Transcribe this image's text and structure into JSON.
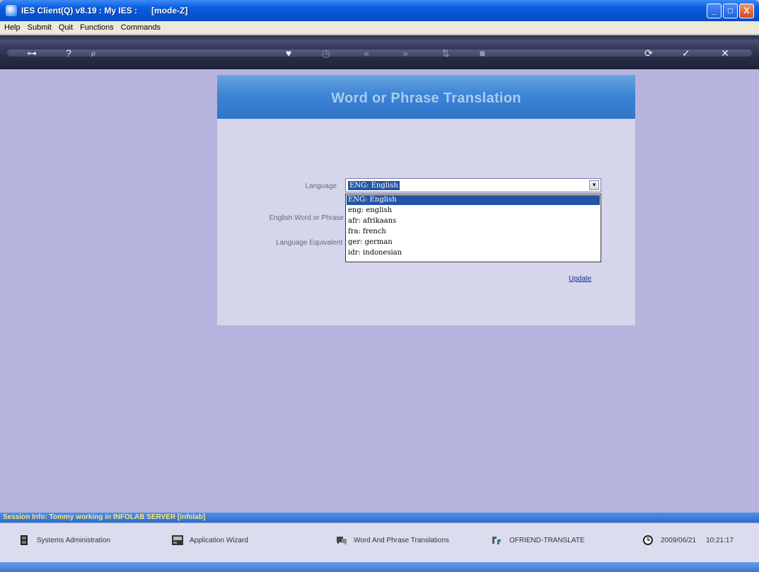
{
  "window": {
    "title": "IES Client(Q) v8.19 : My IES :      [mode-Z]",
    "min_label": "_",
    "max_label": "□",
    "close_label": "X"
  },
  "menu": {
    "items": [
      "Help",
      "Submit",
      "Quit",
      "Functions",
      "Commands"
    ]
  },
  "toolbar": {
    "icons": [
      "key-icon",
      "help-icon",
      "search-icon",
      "heart-icon",
      "clock-icon",
      "rewind-icon",
      "forward-icon",
      "sort-icon",
      "stop-icon",
      "refresh-icon",
      "check-icon",
      "close-icon"
    ]
  },
  "dialog": {
    "title": "Word or Phrase Translation",
    "language_label": "Language",
    "english_label": "English Word or Phrase",
    "equivalent_label": "Language Equivalent",
    "language_value": "ENG: English",
    "options": [
      "ENG: English",
      "eng: english",
      "afr: afrikaans",
      "fra: french",
      "ger: german",
      "idr: indonesian"
    ],
    "selected_option": 0,
    "update_link": "Update"
  },
  "session": {
    "info": "Session Info: Tommy working in INFOLAB SERVER  [infolab]"
  },
  "status": {
    "systems_admin": "Systems Administration",
    "app_wizard": "Application Wizard",
    "translations": "Word And Phrase Translations",
    "ofriend": "OFRIEND-TRANSLATE",
    "date": "2009/06/21",
    "time": "10:21:17"
  }
}
